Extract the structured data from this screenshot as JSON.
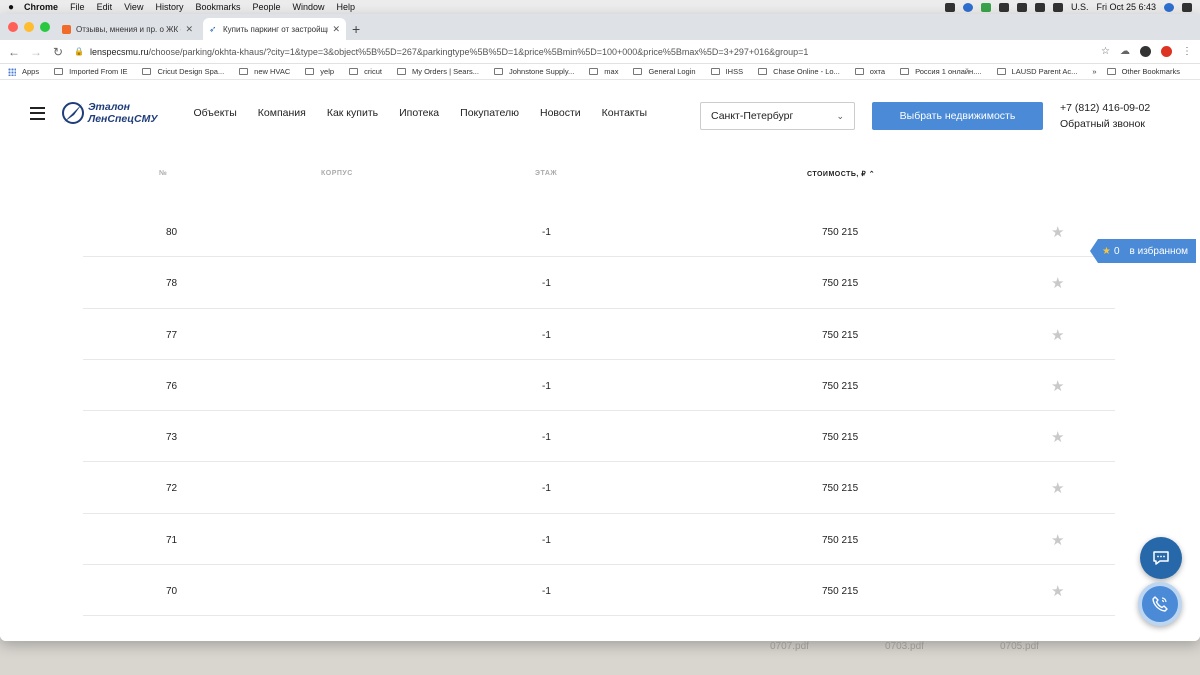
{
  "menubar": {
    "app": "Chrome",
    "items": [
      "File",
      "Edit",
      "View",
      "History",
      "Bookmarks",
      "People",
      "Window",
      "Help"
    ],
    "locale": "U.S.",
    "clock": "Fri Oct 25  6:43"
  },
  "tabs": [
    {
      "title": "Отзывы, мнения и пр. о ЖК «",
      "active": false
    },
    {
      "title": "Купить паркинг от застройщи",
      "active": true
    }
  ],
  "toolbar": {
    "url_host": "lenspecsmu.ru",
    "url_path": "/choose/parking/okhta-khaus/?city=1&type=3&object%5B%5D=267&parkingtype%5B%5D=1&price%5Bmin%5D=100+000&price%5Bmax%5D=3+297+016&group=1"
  },
  "bookmarks": {
    "items": [
      "Apps",
      "Imported From IE",
      "Cricut Design Spa...",
      "new HVAC",
      "yelp",
      "cricut",
      "My Orders | Sears...",
      "Johnstone Supply...",
      "max",
      "General Login",
      "IHSS",
      "Chase Online - Lo...",
      "охта",
      "Россия 1 онлайн....",
      "LAUSD Parent Ac..."
    ],
    "more": "»",
    "other": "Other Bookmarks"
  },
  "site": {
    "logo_line1": "Эталон",
    "logo_line2": "ЛенСпецСМУ",
    "nav": [
      "Объекты",
      "Компания",
      "Как купить",
      "Ипотека",
      "Покупателю",
      "Новости",
      "Контакты"
    ],
    "city": "Санкт-Петербург",
    "cta": "Выбрать недвижимость",
    "phone": "+7 (812) 416-09-02",
    "callback": "Обратный звонок"
  },
  "table": {
    "headers": {
      "num": "№",
      "building": "КОРПУС",
      "floor": "ЭТАЖ",
      "price": "СТОИМОСТЬ, ₽"
    },
    "rows": [
      {
        "num": "80",
        "floor": "-1",
        "price": "750 215"
      },
      {
        "num": "78",
        "floor": "-1",
        "price": "750 215"
      },
      {
        "num": "77",
        "floor": "-1",
        "price": "750 215"
      },
      {
        "num": "76",
        "floor": "-1",
        "price": "750 215"
      },
      {
        "num": "73",
        "floor": "-1",
        "price": "750 215"
      },
      {
        "num": "72",
        "floor": "-1",
        "price": "750 215"
      },
      {
        "num": "71",
        "floor": "-1",
        "price": "750 215"
      },
      {
        "num": "70",
        "floor": "-1",
        "price": "750 215"
      }
    ]
  },
  "favorites": {
    "count": "0",
    "label": "в избранном"
  },
  "desktop_files": [
    "0707.pdf",
    "0703.pdf",
    "0705.pdf"
  ],
  "colors": {
    "accent": "#4a8ad6",
    "brand": "#1f3d7a"
  }
}
